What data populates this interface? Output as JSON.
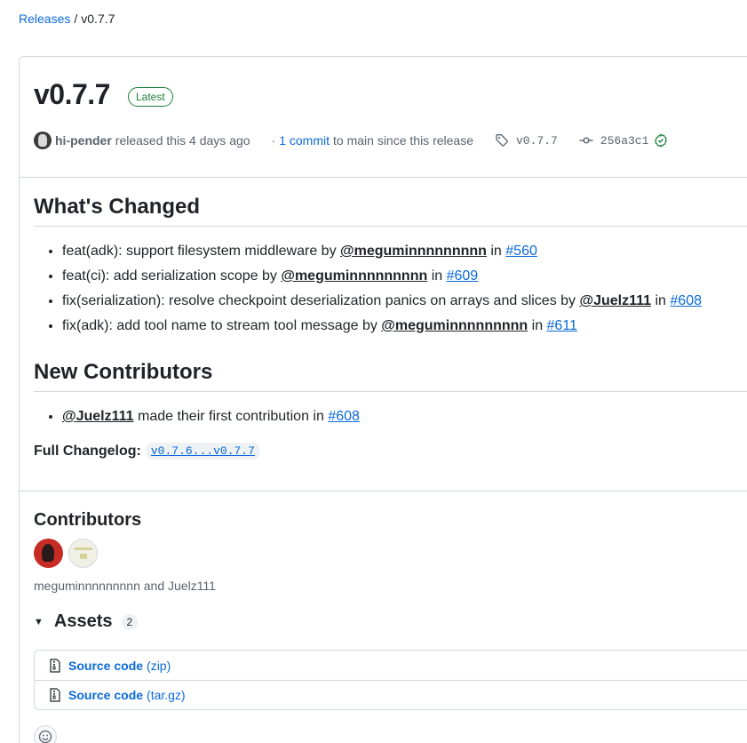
{
  "breadcrumb": {
    "releases_label": "Releases",
    "separator": "/",
    "current": "v0.7.7"
  },
  "release": {
    "title": "v0.7.7",
    "badge": "Latest",
    "author": "hi-pender",
    "released_text": "released this 4 days ago",
    "dot": "·",
    "commits_link": "1 commit",
    "commits_suffix": "to main since this release",
    "tag": "v0.7.7",
    "commit_sha": "256a3c1"
  },
  "whats_changed": {
    "heading": "What's Changed",
    "items": [
      {
        "text": "feat(adk): support filesystem middleware by ",
        "user": "@meguminnnnnnnnn",
        "in": " in ",
        "pr": "#560"
      },
      {
        "text": "feat(ci): add serialization scope by ",
        "user": "@meguminnnnnnnnn",
        "in": " in ",
        "pr": "#609"
      },
      {
        "text": "fix(serialization): resolve checkpoint deserialization panics on arrays and slices by ",
        "user": "@Juelz111",
        "in": " in ",
        "pr": "#608"
      },
      {
        "text": "fix(adk): add tool name to stream tool message by ",
        "user": "@meguminnnnnnnnn",
        "in": " in ",
        "pr": "#611"
      }
    ]
  },
  "new_contributors": {
    "heading": "New Contributors",
    "items": [
      {
        "user": "@Juelz111",
        "text": " made their first contribution in ",
        "pr": "#608"
      }
    ]
  },
  "changelog": {
    "label": "Full Changelog",
    "colon": ":",
    "link": "v0.7.6...v0.7.7"
  },
  "contributors": {
    "heading": "Contributors",
    "names": "meguminnnnnnnnn and Juelz111"
  },
  "assets": {
    "heading": "Assets",
    "count": "2",
    "items": [
      {
        "name": "Source code",
        "ext": "(zip)"
      },
      {
        "name": "Source code",
        "ext": "(tar.gz)"
      }
    ]
  },
  "colors": {
    "link": "#0969da",
    "latest_badge": "#1a7f37",
    "verified": "#1a7f37"
  }
}
